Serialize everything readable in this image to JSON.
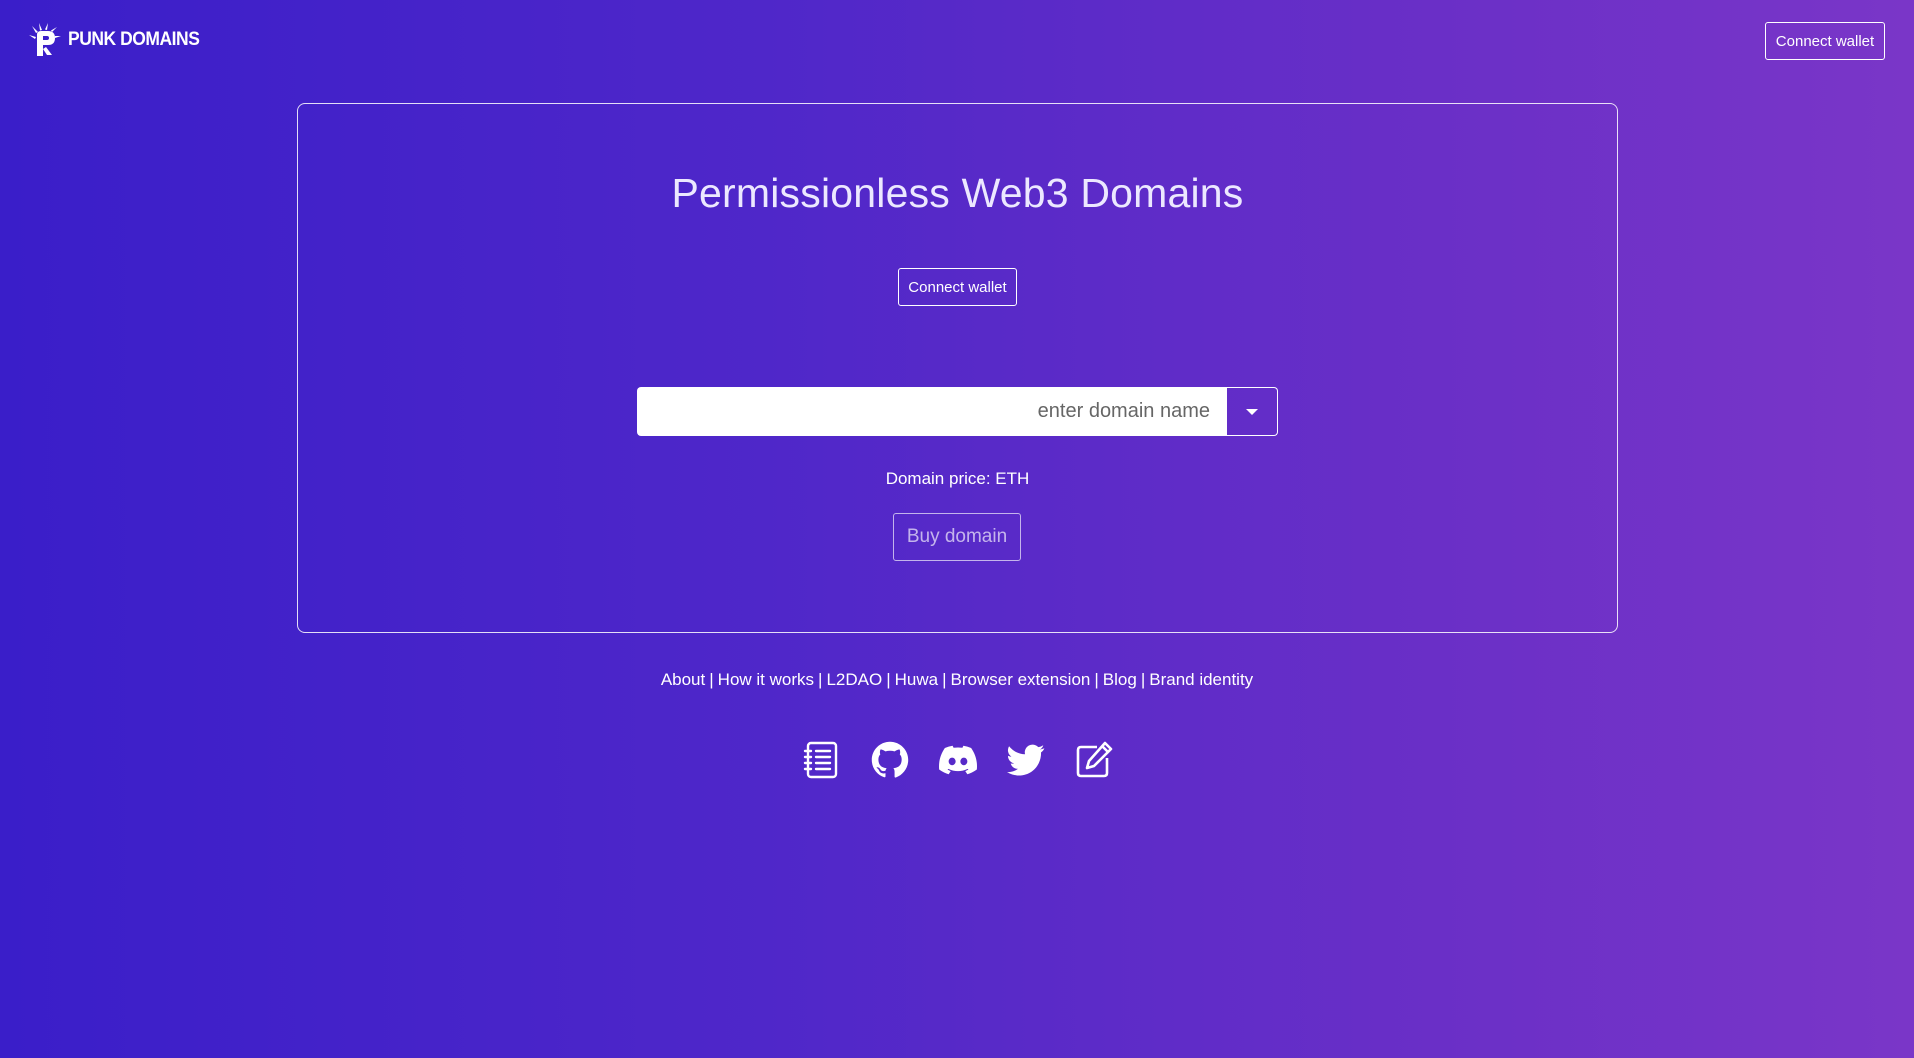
{
  "header": {
    "brand_name": "PUNK DOMAINS",
    "connect_label": "Connect wallet"
  },
  "main": {
    "title": "Permissionless Web3 Domains",
    "connect_label": "Connect wallet",
    "domain_input": {
      "value": "",
      "placeholder": "enter domain name"
    },
    "tld_dropdown": {
      "icon": "caret-down-icon",
      "selected": ""
    },
    "price_text": "Domain price: ETH",
    "buy_label": "Buy domain"
  },
  "footer": {
    "links": [
      {
        "label": "About"
      },
      {
        "label": "How it works"
      },
      {
        "label": "L2DAO"
      },
      {
        "label": "Huwa"
      },
      {
        "label": "Browser extension"
      },
      {
        "label": "Blog"
      },
      {
        "label": "Brand identity"
      }
    ],
    "separator": "|",
    "socials": [
      {
        "icon": "docs-icon"
      },
      {
        "icon": "github-icon"
      },
      {
        "icon": "discord-icon"
      },
      {
        "icon": "twitter-icon"
      },
      {
        "icon": "edit-icon"
      }
    ]
  },
  "colors": {
    "background_start": "#3a1ec9",
    "background_end": "#7a36c8",
    "text": "#ffffff",
    "input_bg": "#ffffff"
  }
}
